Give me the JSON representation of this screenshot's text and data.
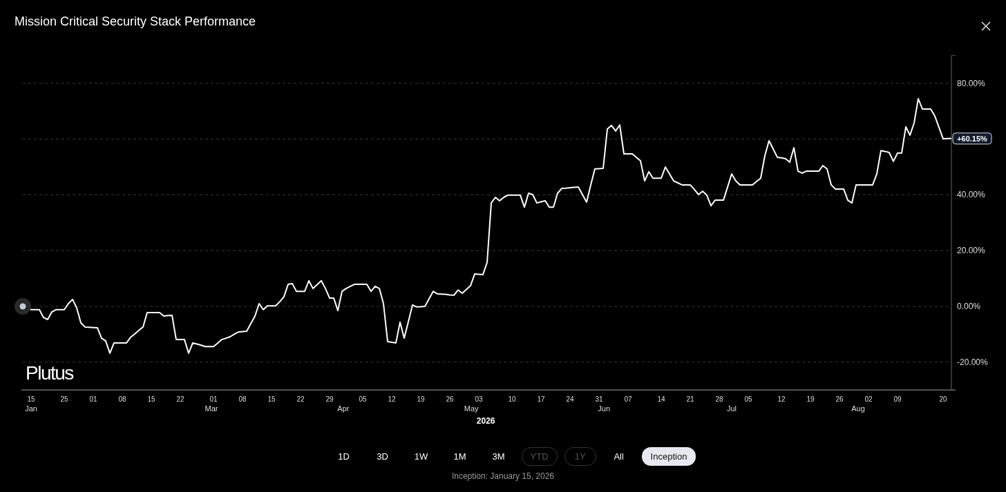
{
  "window": {
    "title": "Mission Critical Security Stack Performance"
  },
  "chart": {
    "brand": "Plutus",
    "current_value": "+60.15%",
    "chart_data": {
      "type": "line",
      "xlabel": "2026",
      "grid": true,
      "categories": [
        null,
        null,
        "15",
        null,
        null,
        null,
        null,
        null,
        null,
        null,
        "25",
        null,
        null,
        null,
        null,
        null,
        null,
        "01",
        null,
        null,
        null,
        null,
        null,
        null,
        "08",
        null,
        null,
        null,
        null,
        null,
        null,
        "15",
        null,
        null,
        null,
        null,
        null,
        null,
        "22",
        null,
        null,
        null,
        null,
        null,
        null,
        null,
        "01",
        null,
        null,
        null,
        null,
        null,
        null,
        "08",
        null,
        null,
        null,
        null,
        null,
        null,
        "15",
        null,
        null,
        null,
        null,
        null,
        null,
        "22",
        null,
        null,
        null,
        null,
        null,
        null,
        "29",
        null,
        null,
        null,
        null,
        null,
        null,
        null,
        "05",
        null,
        null,
        null,
        null,
        null,
        null,
        "12",
        null,
        null,
        null,
        null,
        null,
        null,
        "19",
        null,
        null,
        null,
        null,
        null,
        null,
        "26",
        null,
        null,
        null,
        null,
        null,
        null,
        "03",
        null,
        null,
        null,
        null,
        null,
        null,
        null,
        "10",
        null,
        null,
        null,
        null,
        null,
        null,
        "17",
        null,
        null,
        null,
        null,
        null,
        null,
        "24",
        null,
        null,
        null,
        null,
        null,
        null,
        "31",
        null,
        null,
        null,
        null,
        null,
        null,
        "07",
        null,
        null,
        null,
        null,
        null,
        null,
        null,
        "14",
        null,
        null,
        null,
        null,
        null,
        null,
        "21",
        null,
        null,
        null,
        null,
        null,
        null,
        "28",
        null,
        null,
        null,
        null,
        null,
        null,
        "05",
        null,
        null,
        null,
        null,
        null,
        null,
        null,
        "12",
        null,
        null,
        null,
        null,
        null,
        null,
        "19",
        null,
        null,
        null,
        null,
        null,
        null,
        "26",
        null,
        null,
        null,
        null,
        null,
        null,
        "02",
        null,
        null,
        null,
        null,
        null,
        null,
        "09",
        null,
        null,
        null,
        null,
        null,
        null,
        null,
        null,
        null,
        null,
        "20",
        null,
        null
      ],
      "series": [
        {
          "color": "#ffffff",
          "values": [
            0,
            -0.6,
            -1.2,
            -1.2,
            -1.2,
            -4.0,
            -4.7,
            -2.0,
            -1.2,
            -1.2,
            -1.2,
            1.0,
            2.5,
            -0.5,
            -5.9,
            -7.4,
            -7.5,
            -7.6,
            -7.7,
            -11.4,
            -12.4,
            -16.8,
            -13.1,
            -13.1,
            -13.1,
            -13.1,
            -11.1,
            -9.9,
            -8.6,
            -7.4,
            -2.2,
            -2.2,
            -2.2,
            -2.2,
            -3.5,
            -3.3,
            -3.2,
            -11.9,
            -11.9,
            -11.9,
            -16.8,
            -13.1,
            -13.5,
            -13.9,
            -14.4,
            -14.4,
            -14.4,
            -13.2,
            -11.9,
            -11.4,
            -10.9,
            -10.0,
            -9.2,
            -9.0,
            -8.9,
            -6.2,
            -3.5,
            1.0,
            -1.2,
            0.2,
            0.2,
            0.2,
            1.7,
            3.5,
            7.9,
            8.2,
            5.4,
            5.4,
            5.4,
            9.2,
            6.4,
            7.8,
            9.2,
            6.4,
            3.0,
            3.0,
            -1.5,
            5.4,
            6.4,
            7.2,
            7.9,
            7.9,
            7.9,
            7.9,
            5.4,
            7.2,
            6.4,
            1.0,
            -12.6,
            -12.9,
            -13.1,
            -5.7,
            -11.4,
            -5.5,
            0.5,
            -0.2,
            -0.1,
            0.0,
            2.7,
            5.4,
            4.5,
            4.4,
            4.3,
            4.1,
            4.0,
            5.9,
            4.7,
            6.1,
            7.4,
            11.6,
            11.5,
            11.4,
            15.8,
            37.1,
            39.1,
            37.9,
            39.1,
            39.9,
            39.9,
            39.9,
            39.9,
            35.6,
            40.6,
            40.1,
            37.1,
            37.5,
            37.9,
            35.6,
            35.6,
            40.6,
            42.3,
            42.4,
            42.6,
            42.7,
            42.8,
            40.1,
            37.4,
            43.6,
            49.3,
            49.4,
            49.5,
            63.6,
            64.9,
            62.9,
            65.1,
            54.7,
            54.7,
            54.7,
            53.5,
            52.2,
            45.0,
            48.3,
            46.0,
            46.0,
            46.0,
            50.0,
            47.5,
            45.0,
            44.3,
            43.6,
            43.6,
            43.6,
            41.9,
            40.1,
            41.3,
            39.9,
            36.1,
            38.1,
            38.1,
            38.1,
            42.8,
            47.5,
            45.0,
            43.6,
            43.6,
            43.6,
            43.6,
            44.8,
            46.0,
            54.0,
            59.4,
            56.5,
            53.5,
            53.3,
            53.0,
            51.7,
            56.9,
            48.5,
            47.8,
            48.5,
            48.5,
            48.5,
            48.5,
            50.5,
            49.3,
            43.6,
            42.1,
            42.1,
            42.1,
            38.1,
            37.1,
            43.6,
            43.6,
            43.6,
            43.6,
            43.6,
            47.5,
            55.9,
            55.6,
            55.2,
            52.0,
            55.0,
            55.0,
            64.4,
            61.4,
            65.8,
            74.5,
            70.8,
            70.8,
            70.8,
            68.3,
            64.2,
            60.1,
            60.2,
            60.2
          ]
        }
      ],
      "ylim": [
        -30,
        90
      ],
      "yticks": [
        {
          "value": -20,
          "label": "-20.00%"
        },
        {
          "value": 0,
          "label": "0.00%"
        },
        {
          "value": 20,
          "label": "20.00%"
        },
        {
          "value": 40,
          "label": "40.00%"
        },
        {
          "value": 80,
          "label": "80.00%"
        }
      ],
      "annotations": [
        "Jan",
        "Mar",
        "Apr",
        "May",
        "Jun",
        "Jul",
        "Aug"
      ]
    }
  },
  "range_buttons": [
    {
      "label": "1D",
      "selected": false,
      "disabled": false
    },
    {
      "label": "3D",
      "selected": false,
      "disabled": false
    },
    {
      "label": "1W",
      "selected": false,
      "disabled": false
    },
    {
      "label": "1M",
      "selected": false,
      "disabled": false
    },
    {
      "label": "3M",
      "selected": false,
      "disabled": false
    },
    {
      "label": "YTD",
      "selected": false,
      "disabled": true
    },
    {
      "label": "1Y",
      "selected": false,
      "disabled": true
    },
    {
      "label": "All",
      "selected": false,
      "disabled": false
    },
    {
      "label": "Inception",
      "selected": true,
      "disabled": false
    }
  ],
  "footnote": "Inception: January 15, 2026"
}
